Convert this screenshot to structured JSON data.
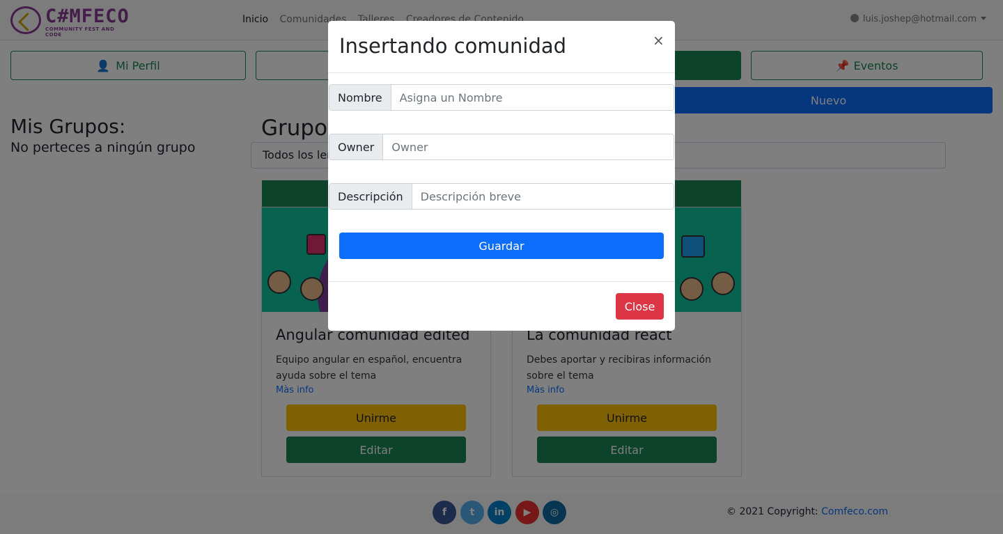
{
  "navbar": {
    "logo_title": "C#MFECO",
    "logo_subtitle": "COMMUNITY FEST AND CODE",
    "links": [
      "Inicio",
      "Comunidades",
      "Talleres",
      "Creadores de Contenido"
    ],
    "user_email": "luis.joshep@hotmail.com"
  },
  "main": {
    "buttons": {
      "perfil": "Mi Perfil",
      "eventos": "Eventos",
      "nuevo": "Nuevo"
    },
    "mis_grupos_title": "Mis Grupos:",
    "mis_grupos_empty": "No perteces a ningún grupo",
    "grupos_title": "Grupos",
    "filter_value": "Todos los lenguajes"
  },
  "cards": [
    {
      "title": "Angular comunidad edited",
      "text": "Equipo angular en español, encuentra ayuda sobre el tema",
      "link": "Màs info",
      "join": "Unirme",
      "edit": "Editar"
    },
    {
      "title": "La comunidad react",
      "text": "Debes aportar y recibiras información sobre el tema",
      "link": "Màs info",
      "join": "Unirme",
      "edit": "Editar"
    }
  ],
  "footer": {
    "social": [
      "f",
      "t",
      "in",
      "▶",
      "◎"
    ],
    "copyright": "© 2021 Copyright:",
    "site": "Comfeco.com"
  },
  "modal": {
    "title": "Insertando comunidad",
    "close_x": "×",
    "fields": [
      {
        "label": "Nombre",
        "placeholder": "Asigna un Nombre"
      },
      {
        "label": "Owner",
        "placeholder": "Owner"
      },
      {
        "label": "Descripción",
        "placeholder": "Descripción breve"
      }
    ],
    "save": "Guardar",
    "close": "Close"
  },
  "colors": {
    "primary": "#0d6efd",
    "success": "#198754",
    "warning": "#ffc107",
    "danger": "#dc3545",
    "brand": "#8a3a96"
  }
}
